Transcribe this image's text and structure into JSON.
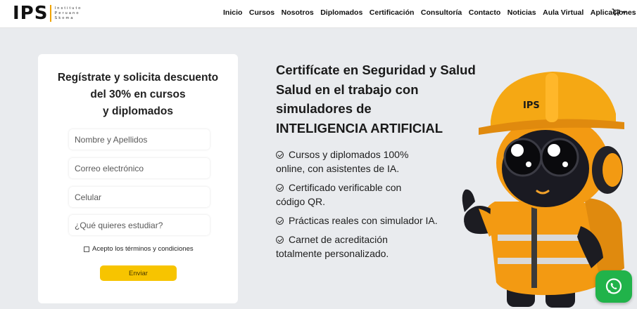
{
  "header": {
    "logo": {
      "mark": "IPS",
      "sub": [
        "Instituto",
        "Peruano",
        "Skoma"
      ]
    },
    "nav": [
      {
        "label": "Inicio"
      },
      {
        "label": "Cursos"
      },
      {
        "label": "Nosotros"
      },
      {
        "label": "Diplomados"
      },
      {
        "label": "Certificación"
      },
      {
        "label": "Consultoría"
      },
      {
        "label": "Contacto"
      },
      {
        "label": "Noticias"
      },
      {
        "label": "Aula Virtual"
      },
      {
        "label": "Aplicaciones",
        "dropdown": true
      }
    ],
    "cart_icon": "cart-icon"
  },
  "form": {
    "title_lines": [
      "Regístrate y solicita descuento",
      "del 30% en cursos",
      "y diplomados"
    ],
    "fields": {
      "name": {
        "placeholder": "Nombre y Apellidos",
        "value": ""
      },
      "email": {
        "placeholder": "Correo electrónico",
        "value": ""
      },
      "phone": {
        "placeholder": "Celular",
        "value": ""
      },
      "study": {
        "placeholder": "¿Qué quieres estudiar?",
        "value": ""
      }
    },
    "terms_label": "Acepto los términos y condiciones",
    "terms_checked": false,
    "submit_label": "Enviar"
  },
  "hero": {
    "title_lines": [
      "Certifícate en Seguridad y Salud",
      "Salud en el trabajo con",
      "simuladores de",
      "INTELIGENCIA ARTIFICIAL"
    ],
    "features": [
      {
        "icon": "check-circle-icon",
        "lines": [
          "Cursos y diplomados 100%",
          "online, con asistentes de IA."
        ]
      },
      {
        "icon": "check-circle-icon",
        "lines": [
          "Certificado verificable con",
          "código QR."
        ]
      },
      {
        "icon": "check-circle-icon",
        "lines": [
          "Prácticas reales con simulador IA."
        ]
      },
      {
        "icon": "check-circle-icon",
        "lines": [
          "Carnet de acreditación",
          "totalmente personalizado."
        ]
      }
    ]
  },
  "mascot": {
    "helmet_text": "IPS"
  },
  "whatsapp_icon": "whatsapp-icon",
  "colors": {
    "accent_yellow": "#f7c400",
    "whatsapp_green": "#21b34a",
    "page_bg": "#e9ebee",
    "mascot_orange": "#f39a12"
  }
}
